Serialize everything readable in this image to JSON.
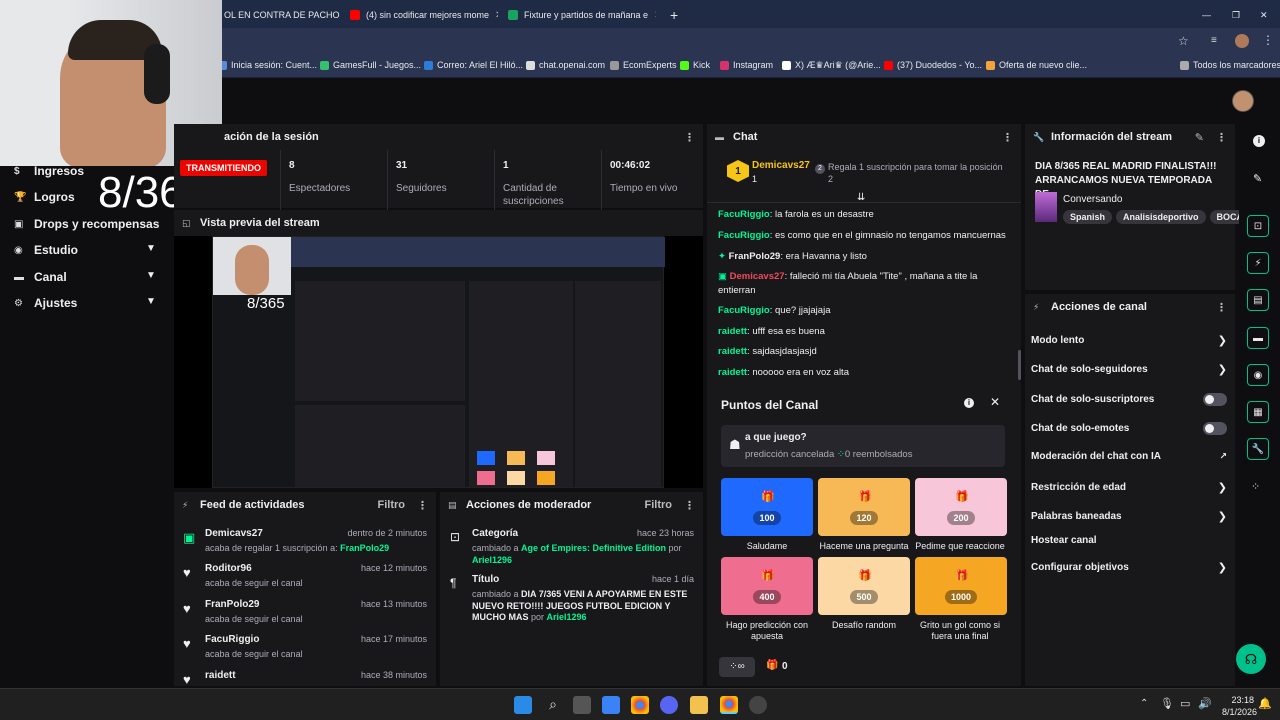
{
  "tabs": [
    {
      "label": "OL EN CONTRA DE PACHO"
    },
    {
      "label": "(4) sin codificar mejores mome"
    },
    {
      "label": "Fixture y partidos de mañana e"
    }
  ],
  "bookmarks": [
    "Inicia sesión: Cuent...",
    "GamesFull - Juegos...",
    "Correo: Ariel El Hiló...",
    "chat.openai.com",
    "EcomExperts",
    "Kick",
    "Instagram",
    "X) Æ♛Ari♛ (@Arie...",
    "(37) Duodedos - Yo...",
    "Oferta de nuevo clie...",
    "Todos los marcadores"
  ],
  "overlay": {
    "counter": "8/365"
  },
  "nav": [
    {
      "label": "Ingresos"
    },
    {
      "label": "Logros"
    },
    {
      "label": "Drops y recompensas"
    },
    {
      "label": "Estudio"
    },
    {
      "label": "Canal"
    },
    {
      "label": "Ajustes"
    }
  ],
  "session": {
    "title": "ación de la sesión",
    "live": "TRANSMITIENDO",
    "stats": [
      {
        "value": "8",
        "label": "Espectadores"
      },
      {
        "value": "31",
        "label": "Seguidores"
      },
      {
        "value": "1",
        "label": "Cantidad de suscripciones"
      },
      {
        "value": "00:46:02",
        "label": "Tiempo en vivo"
      }
    ]
  },
  "preview": {
    "title": "Vista previa del stream"
  },
  "chat": {
    "title": "Chat",
    "pinned_user": "Demicavs27",
    "pinned_count": "1",
    "gift_text": "Regala 1 suscripción para tomar la posición 2",
    "gift_num": "2",
    "messages": [
      {
        "user": "FacuRiggio",
        "text": ": la farola es un desastre"
      },
      {
        "user": "FacuRiggio",
        "text": ": es como que en el gimnasio no tengamos mancuernas"
      },
      {
        "user": "FranPolo29",
        "text": ": era Havanna y listo"
      },
      {
        "user": "Demicavs27",
        "text": ": falleció mi tía Abuela \"Tite\" , mañana a tite la entierran"
      },
      {
        "user": "FacuRiggio",
        "text": ": que? jjajajaja"
      },
      {
        "user": "raidett",
        "text": ": ufff esa es buena"
      },
      {
        "user": "raidett",
        "text": ": sajdasjdasjasjd"
      },
      {
        "user": "raidett",
        "text": ": nooooo era en voz alta"
      }
    ]
  },
  "points": {
    "title": "Puntos del Canal",
    "prediction_q": "a que juego?",
    "prediction_status": "predicción cancelada",
    "refunded": "0 reembolsados",
    "rewards": [
      {
        "cost": "100",
        "label": "Saludame",
        "color": "#1f69ff"
      },
      {
        "cost": "120",
        "label": "Haceme una pregunta",
        "color": "#f7b955"
      },
      {
        "cost": "200",
        "label": "Pedime que reaccione",
        "color": "#f7c6d8"
      },
      {
        "cost": "400",
        "label": "Hago predicción con apuesta",
        "color": "#ef6d8f"
      },
      {
        "cost": "500",
        "label": "Desafío random",
        "color": "#fcd9a4"
      },
      {
        "cost": "1000",
        "label": "Grito un gol como si fuera una final",
        "color": "#f5a623"
      }
    ],
    "footer_count": "0"
  },
  "stream_info": {
    "title": "Información del stream",
    "stream_title": "DIA 8/365 REAL MADRID FINALISTA!!! ARRANCAMOS NUEVA TEMPORADA DE...",
    "category": "Conversando",
    "tags": [
      "Spanish",
      "Analisisdeportivo",
      "BOCA..."
    ]
  },
  "channel_actions": {
    "title": "Acciones de canal",
    "items": [
      {
        "label": "Modo lento",
        "kind": "arrow"
      },
      {
        "label": "Chat de solo-seguidores",
        "kind": "arrow"
      },
      {
        "label": "Chat de solo-suscriptores",
        "kind": "toggle"
      },
      {
        "label": "Chat de solo-emotes",
        "kind": "toggle"
      },
      {
        "label": "Moderación del chat con IA",
        "kind": "external"
      },
      {
        "label": "Restricción de edad",
        "kind": "arrow"
      },
      {
        "label": "Palabras baneadas",
        "kind": "arrow"
      },
      {
        "label": "Hostear canal",
        "kind": "none"
      },
      {
        "label": "Configurar objetivos",
        "kind": "arrow"
      }
    ]
  },
  "activity": {
    "title": "Feed de actividades",
    "filter": "Filtro",
    "items": [
      {
        "user": "Demicavs27",
        "sub": "acaba de regalar 1 suscripción a: ",
        "target": "FranPolo29",
        "time": "dentro de 2 minutos"
      },
      {
        "user": "Roditor96",
        "sub": "acaba de seguir el canal",
        "target": "",
        "time": "hace 12 minutos"
      },
      {
        "user": "FranPolo29",
        "sub": "acaba de seguir el canal",
        "target": "",
        "time": "hace 13 minutos"
      },
      {
        "user": "FacuRiggio",
        "sub": "acaba de seguir el canal",
        "target": "",
        "time": "hace 17 minutos"
      },
      {
        "user": "raidett",
        "sub": "",
        "target": "",
        "time": "hace 38 minutos"
      }
    ]
  },
  "mod_actions": {
    "title": "Acciones de moderador",
    "filter": "Filtro",
    "items": [
      {
        "heading": "Categoría",
        "time": "hace 23 horas",
        "pre": "cambiado a ",
        "value": "Age of Empires: Definitive Edition",
        "post": " por ",
        "user": "Ariel1296"
      },
      {
        "heading": "Título",
        "time": "hace 1 día",
        "pre": "cambiado a ",
        "value": "DIA 7/365 VENI A APOYARME EN ESTE NUEVO RETO!!!! JUEGOS FUTBOL EDICION Y MUCHO MAS",
        "post": " por ",
        "user": "Ariel1296"
      }
    ]
  },
  "taskbar": {
    "time": "23:18",
    "date": "8/1/2026"
  },
  "colors": {
    "accent": "#00f593",
    "live": "#eb0400",
    "panel": "#18181b",
    "bg": "#0e0e10"
  }
}
